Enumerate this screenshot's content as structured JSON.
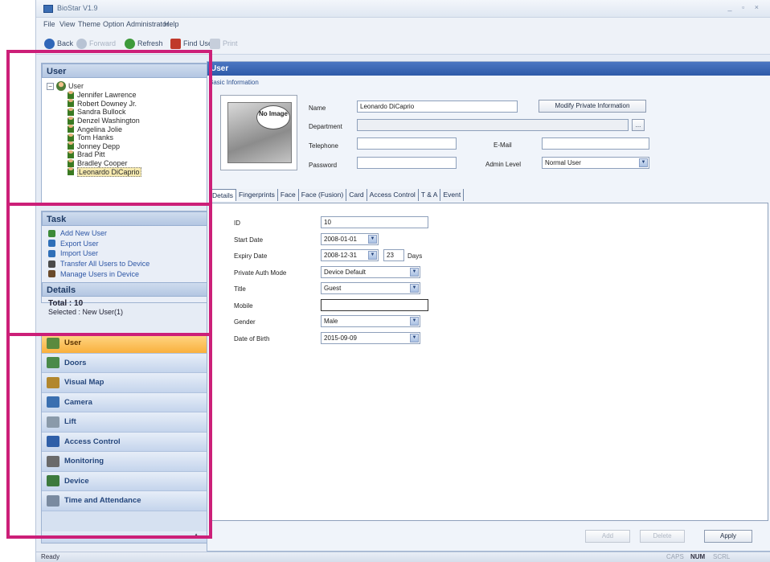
{
  "window": {
    "title": "BioStar V1.9"
  },
  "menu": [
    "File",
    "View",
    "Theme",
    "Option",
    "Administrator",
    "Help"
  ],
  "toolbar": {
    "back": "Back",
    "forward": "Forward",
    "refresh": "Refresh",
    "find_user": "Find User",
    "print": "Print"
  },
  "user_panel": {
    "title": "User",
    "root": "User",
    "users": [
      "Jennifer Lawrence",
      "Robert Downey Jr.",
      "Sandra Bullock",
      "Denzel Washington",
      "Angelina Jolie",
      "Tom Hanks",
      "Jonney Depp",
      "Brad Pitt",
      "Bradley Cooper",
      "Leonardo DiCaprio"
    ]
  },
  "task_panel": {
    "title": "Task",
    "items": [
      "Add New User",
      "Export User",
      "Import User",
      "Transfer All Users to Device",
      "Manage Users in Device"
    ]
  },
  "details_panel": {
    "title": "Details",
    "total": "Total : 10",
    "selected": "Selected : New User(1)"
  },
  "nav": [
    "User",
    "Doors",
    "Visual Map",
    "Camera",
    "Lift",
    "Access Control",
    "Monitoring",
    "Device",
    "Time and Attendance"
  ],
  "main": {
    "header": "User",
    "basic_info": "Basic Information",
    "photo_badge": "No Image",
    "labels": {
      "name": "Name",
      "department": "Department",
      "telephone": "Telephone",
      "password": "Password",
      "email": "E-Mail",
      "admin_level": "Admin Level"
    },
    "values": {
      "name": "Leonardo DiCaprio",
      "admin_level": "Normal User"
    },
    "modify_btn": "Modify Private Information",
    "browse_btn": "..."
  },
  "tabs": [
    "Details",
    "Fingerprints",
    "Face",
    "Face (Fusion)",
    "Card",
    "Access Control",
    "T & A",
    "Event"
  ],
  "details": {
    "fields": [
      {
        "label": "ID",
        "value": "10"
      },
      {
        "label": "Start Date",
        "value": "2008-01-01"
      },
      {
        "label": "Expiry Date",
        "value": "2008-12-31"
      },
      {
        "label": "Private Auth Mode",
        "value": "Device Default"
      },
      {
        "label": "Title",
        "value": "Guest"
      },
      {
        "label": "Mobile",
        "value": ""
      },
      {
        "label": "Gender",
        "value": "Male"
      },
      {
        "label": "Date of Birth",
        "value": "2015-09-09"
      }
    ],
    "expiry_days": "23",
    "days_label": "Days"
  },
  "buttons": {
    "add": "Add",
    "delete": "Delete",
    "apply": "Apply"
  },
  "status": {
    "left": "Ready",
    "caps": "CAPS",
    "num": "NUM",
    "scrl": "SCRL"
  },
  "colors": {
    "highlight": "#cc1f78",
    "header_blue": "#2e5aa8",
    "active_nav": "#f9b03d"
  }
}
